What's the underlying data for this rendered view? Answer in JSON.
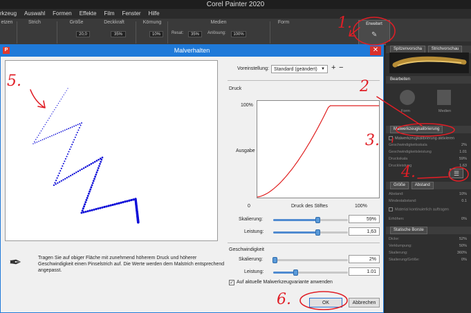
{
  "app": {
    "title": "Corel Painter 2020",
    "menu": [
      "rkzeug",
      "Auswahl",
      "Formen",
      "Effekte",
      "Film",
      "Fenster",
      "Hilfe"
    ]
  },
  "toolbar": {
    "groups": [
      "etzen",
      "Strich",
      "Größe",
      "Deckkraft",
      "Körnung",
      "Medien",
      "Form",
      "Erweitert"
    ],
    "size_value": "20,0",
    "opacity_value": "35%",
    "grain_value": "10%",
    "resat_label": "Resat:",
    "resat_value": "35%",
    "bleed_label": "Anlösung:",
    "bleed_value": "100%"
  },
  "dialog": {
    "title": "Malverhalten",
    "preset_label": "Voreinstellung:",
    "preset_value": "Standard (geändert)",
    "plus": "+",
    "minus": "−",
    "pressure_heading": "Druck",
    "y_max": "100%",
    "y_label": "Ausgabe",
    "x_min": "0",
    "x_label": "Druck des Stiftes",
    "x_max": "100%",
    "scale_label": "Skalierung:",
    "scale_value": "59%",
    "scale_fraction": 0.59,
    "power_label": "Leistung:",
    "power_value": "1,63",
    "power_fraction": 0.59,
    "speed_heading": "Geschwindigkeit",
    "speed_scale_label": "Skalierung:",
    "speed_scale_value": "2%",
    "speed_scale_fraction": 0.02,
    "speed_power_label": "Leistung:",
    "speed_power_value": "1.01",
    "speed_power_fraction": 0.3,
    "apply_label": "Auf aktuelle Malwerkzeugvariante anwenden",
    "apply_checked": "✓",
    "hint": "Tragen Sie auf obiger Fläche mit zunehmend höherem Druck und höherer Geschwindigkeit einen Pinselstrich auf. Die Werte werden dem Malstrich entsprechend angepasst.",
    "ok": "OK",
    "cancel": "Abbrechen"
  },
  "panels": {
    "preview_tabs": [
      "Spitzenvorscha",
      "Strichvorschau"
    ],
    "edit_heading": "Bearbeiten",
    "edit_items": [
      "Form",
      "Medien"
    ],
    "calibration_heading": "Malwerkzeugkalibrierung",
    "calibration_toggle": "Malwerkzeugkalibrierung aktivieren",
    "calibration_rows": [
      {
        "label": "Geschwindigkeitsskala",
        "value": "2%"
      },
      {
        "label": "Geschwindigkeitsleistung",
        "value": "1.01"
      },
      {
        "label": "Druckskala",
        "value": "59%"
      },
      {
        "label": "Druckleistung",
        "value": "1.63"
      }
    ],
    "size_tabs": [
      "Größe",
      "Abstand"
    ],
    "spacing_rows": [
      {
        "label": "Abstand:",
        "value": "10%"
      },
      {
        "label": "Mindestabstand:",
        "value": "0.1"
      }
    ],
    "continuous_label": "Material kontinuierlich auftragen",
    "increase_label": "Erhöhen:",
    "increase_value": "0%",
    "static_heading": "Statische Borste",
    "static_rows": [
      {
        "label": "Dicke:",
        "value": "52%"
      },
      {
        "label": "Verklumpung:",
        "value": "50%"
      },
      {
        "label": "Skalierung:",
        "value": "360%"
      },
      {
        "label": "Skalierung/Größe:",
        "value": "0%"
      }
    ]
  },
  "annotations": [
    "1.",
    "2",
    "3.",
    "4.",
    "5.",
    "6."
  ],
  "colors": {
    "annotation": "#e01e26",
    "stroke": "#1010d8",
    "curve": "#e02020",
    "title_blue": "#1f7ad9"
  }
}
